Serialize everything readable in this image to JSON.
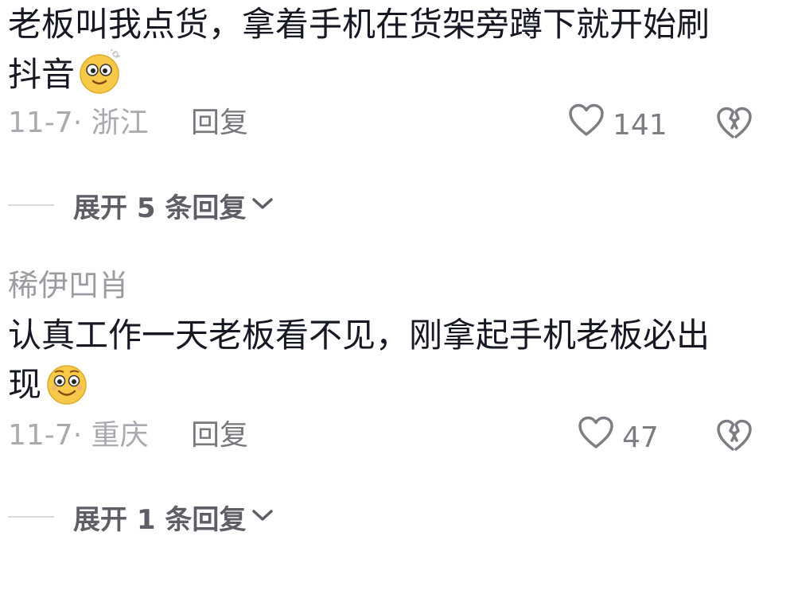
{
  "comments": [
    {
      "text": "老板叫我点货，拿着手机在货架旁蹲下就开始刷抖音",
      "emoji": "dazed-face-emoji",
      "date": "11-7",
      "location": "浙江",
      "reply_label": "回复",
      "likes": "141",
      "expand_label": "展开 5 条回复"
    },
    {
      "username": "稀伊凹肖",
      "text": "认真工作一天老板看不见，刚拿起手机老板必出现",
      "emoji": "smile-face-emoji",
      "date": "11-7",
      "location": "重庆",
      "reply_label": "回复",
      "likes": "47",
      "expand_label": "展开 1 条回复"
    }
  ],
  "icons": {
    "like": "heart-outline-icon",
    "dislike": "broken-heart-icon",
    "expand": "chevron-down-icon"
  },
  "colors": {
    "text": "#161823",
    "muted": "#a9aab0",
    "reply": "#77787e",
    "expand": "#5e5f66",
    "emoji": "#f7c948"
  }
}
